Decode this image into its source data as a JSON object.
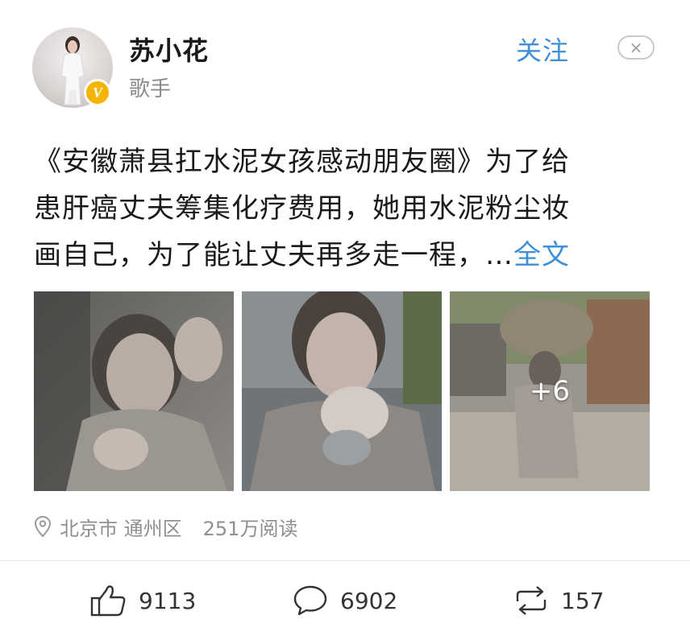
{
  "user": {
    "name": "苏小花",
    "title": "歌手",
    "verified_mark": "V"
  },
  "header": {
    "follow_label": "关注",
    "close_label": "×"
  },
  "post": {
    "lines": [
      "《安徽萧县扛水泥女孩感动朋友圈》为了给",
      "患肝癌丈夫筹集化疗费用，她用水泥粉尘妆",
      "画自己，为了能让丈夫再多走一程，…"
    ],
    "full_text_link": "全文"
  },
  "images": {
    "more_count": "+6",
    "items": [
      "worker-crying-photo",
      "worker-covering-mouth-photo",
      "worker-carrying-sack-photo"
    ]
  },
  "meta": {
    "location_icon": "location-pin-icon",
    "location": "北京市 通州区",
    "reads": "251万阅读"
  },
  "actions": {
    "likes": "9113",
    "comments": "6902",
    "reposts": "157"
  },
  "colors": {
    "accent": "#3f8fd8",
    "verified": "#f5b400",
    "muted": "#8f8f8f"
  }
}
